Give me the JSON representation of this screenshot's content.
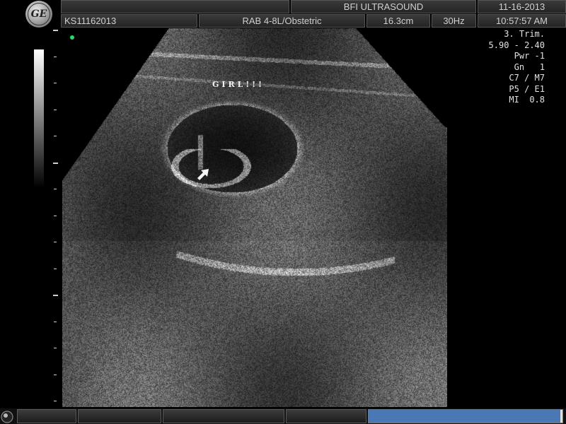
{
  "header": {
    "logo_text": "GE",
    "title": "BFI ULTRASOUND",
    "date": "11-16-2013",
    "patient_id": "KS11162013",
    "probe_preset": "RAB 4-8L/Obstetric",
    "depth": "16.3cm",
    "frame_rate": "30Hz",
    "time": "10:57:57 AM"
  },
  "params": [
    "3. Trim.",
    "5.90 - 2.40",
    "Pwr -1",
    "Gn   1",
    "C7 / M7",
    "P5 / E1",
    "MI  0.8"
  ],
  "annotation": "GIRL!!!",
  "icons": {
    "logo": "ge-logo-icon",
    "arrow": "arrow-pointer-icon",
    "focus": "focus-marker-icon",
    "trackball": "trackball-icon"
  },
  "colors": {
    "focus_marker": "#e0d060",
    "indicator_dot": "#22dd66",
    "progress_fill": "#4a78b4"
  },
  "status": {
    "progress": 0.99
  }
}
